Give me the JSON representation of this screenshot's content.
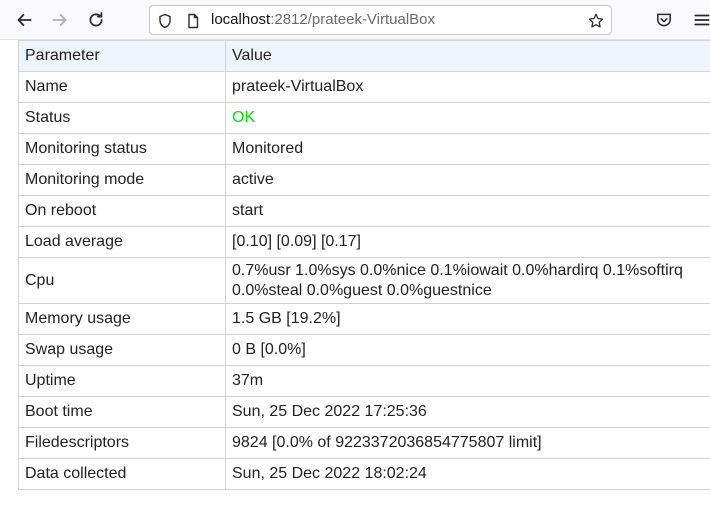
{
  "browser": {
    "url_host": "localhost",
    "url_rest": ":2812/prateek-VirtualBox"
  },
  "table": {
    "header": {
      "param": "Parameter",
      "value": "Value"
    },
    "rows": [
      {
        "param": "Name",
        "value": "prateek-VirtualBox"
      },
      {
        "param": "Status",
        "value": "OK",
        "value_color": "#00e000"
      },
      {
        "param": "Monitoring status",
        "value": "Monitored"
      },
      {
        "param": "Monitoring mode",
        "value": "active"
      },
      {
        "param": "On reboot",
        "value": "start"
      },
      {
        "param": "Load average",
        "value": "[0.10] [0.09] [0.17]"
      },
      {
        "param": "Cpu",
        "value_line1": "0.7%usr 1.0%sys 0.0%nice 0.1%iowait 0.0%hardirq 0.1%softirq",
        "value_line2": "0.0%steal 0.0%guest 0.0%guestnice"
      },
      {
        "param": "Memory usage",
        "value": "1.5 GB [19.2%]"
      },
      {
        "param": "Swap usage",
        "value": "0 B [0.0%]"
      },
      {
        "param": "Uptime",
        "value": "37m"
      },
      {
        "param": "Boot time",
        "value": "Sun, 25 Dec 2022 17:25:36"
      },
      {
        "param": "Filedescriptors",
        "value": "9824 [0.0% of 9223372036854775807 limit]"
      },
      {
        "param": "Data collected",
        "value": "Sun, 25 Dec 2022 18:02:24"
      }
    ]
  },
  "icons": {
    "back": "arrow-left-icon",
    "forward": "arrow-right-icon",
    "reload": "reload-icon",
    "shield": "shield-icon",
    "page": "page-icon",
    "bookmark": "star-icon",
    "pocket": "pocket-icon",
    "menu": "hamburger-menu-icon"
  }
}
